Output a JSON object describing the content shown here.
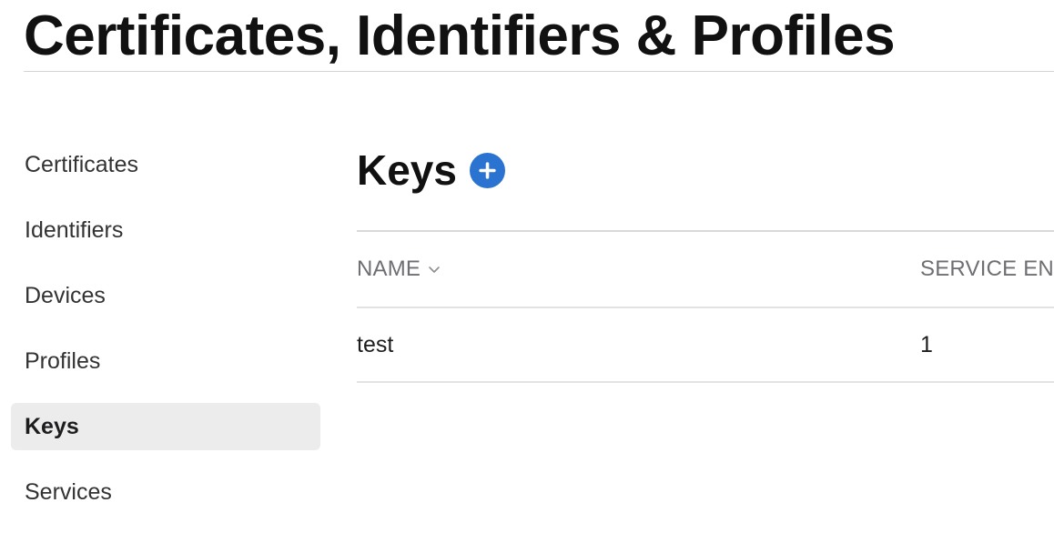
{
  "page": {
    "title": "Certificates, Identifiers & Profiles"
  },
  "sidebar": {
    "items": [
      {
        "label": "Certificates",
        "active": false
      },
      {
        "label": "Identifiers",
        "active": false
      },
      {
        "label": "Devices",
        "active": false
      },
      {
        "label": "Profiles",
        "active": false
      },
      {
        "label": "Keys",
        "active": true
      },
      {
        "label": "Services",
        "active": false
      }
    ]
  },
  "main": {
    "section_title": "Keys",
    "add_button_icon": "plus-circle-icon",
    "table": {
      "columns": [
        {
          "label": "NAME",
          "sort_icon": "chevron-down-icon"
        },
        {
          "label": "SERVICE EN."
        }
      ],
      "rows": [
        {
          "name": "test",
          "services": "1"
        }
      ]
    }
  },
  "colors": {
    "accent": "#2b73d1",
    "active_item_bg": "#ececec",
    "divider": "#d9d9d9",
    "header_text": "#6e6e73"
  }
}
